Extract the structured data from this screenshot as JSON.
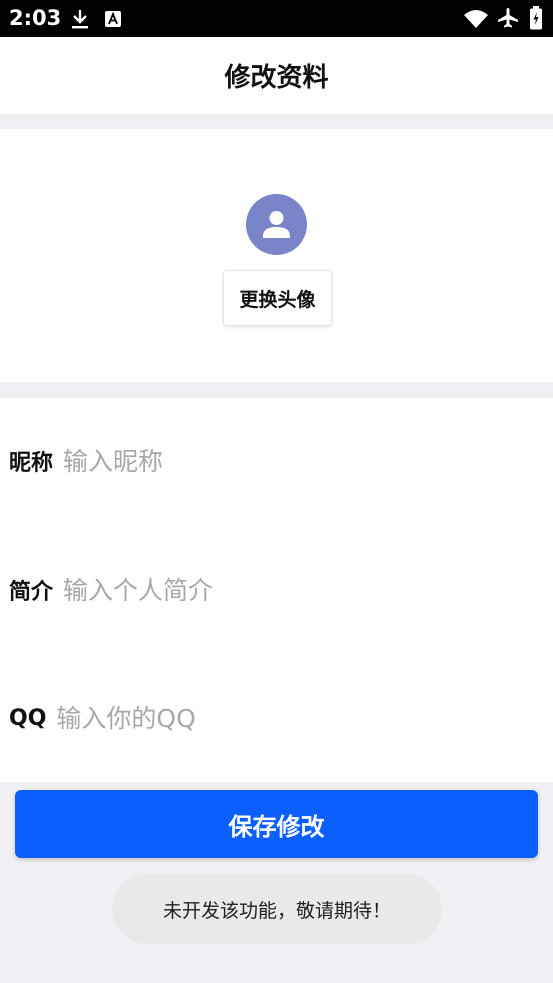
{
  "status_bar": {
    "time": "2:03",
    "left_icons": [
      "download-icon",
      "text-a-icon"
    ],
    "right_icons": [
      "wifi-icon",
      "airplane-icon",
      "battery-icon"
    ]
  },
  "header": {
    "title": "修改资料"
  },
  "avatar_section": {
    "change_avatar_label": "更换头像"
  },
  "form": {
    "nickname": {
      "label": "昵称",
      "placeholder": "输入昵称",
      "value": ""
    },
    "bio": {
      "label": "简介",
      "placeholder": "输入个人简介",
      "value": ""
    },
    "qq": {
      "label": "QQ",
      "placeholder": "输入你的QQ",
      "value": ""
    }
  },
  "save_button": {
    "label": "保存修改"
  },
  "toast": {
    "message": "未开发该功能，敬请期待！"
  },
  "colors": {
    "accent": "#0a5ffe",
    "avatar_bg": "#7985c8",
    "page_bg": "#f0eff4",
    "placeholder": "#a8a8a8"
  }
}
